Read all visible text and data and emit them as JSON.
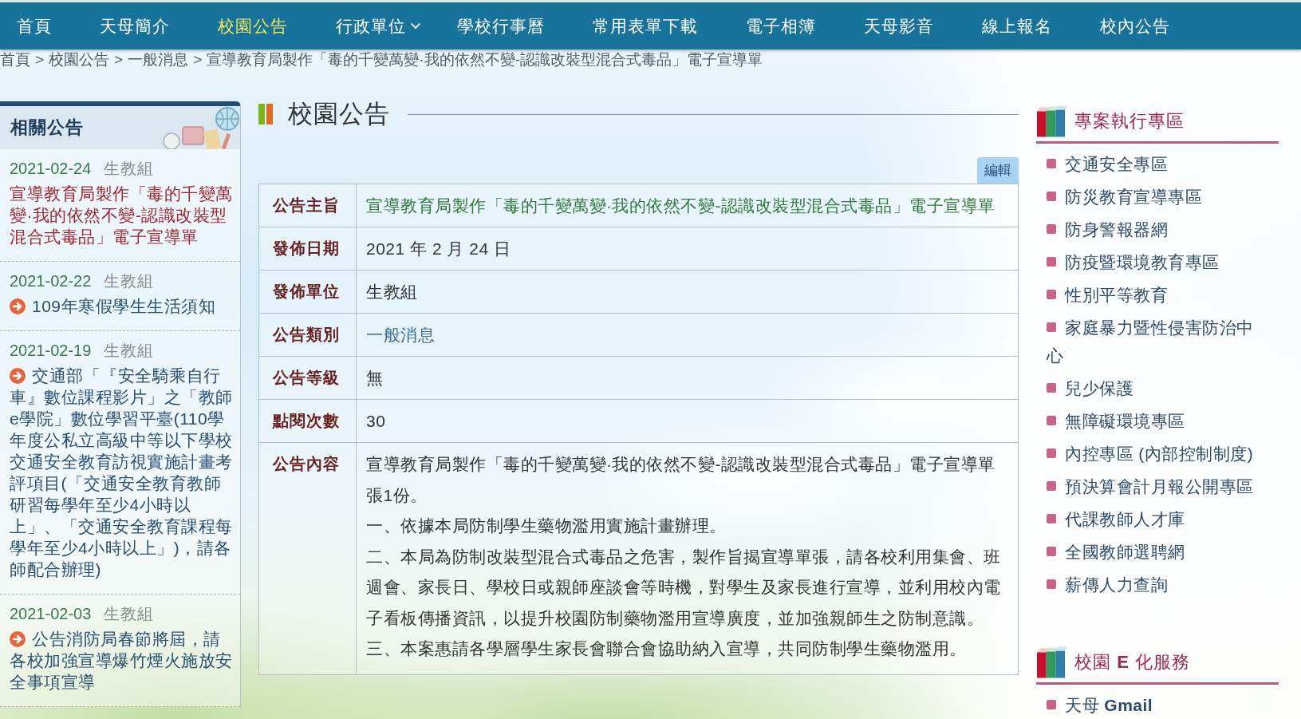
{
  "nav": [
    {
      "label": "首頁",
      "selected": false,
      "dropdown": false
    },
    {
      "label": "天母簡介",
      "selected": false,
      "dropdown": false
    },
    {
      "label": "校園公告",
      "selected": true,
      "dropdown": false
    },
    {
      "label": "行政單位",
      "selected": false,
      "dropdown": true
    },
    {
      "label": "學校行事曆",
      "selected": false,
      "dropdown": false
    },
    {
      "label": "常用表單下載",
      "selected": false,
      "dropdown": false
    },
    {
      "label": "電子相簿",
      "selected": false,
      "dropdown": false
    },
    {
      "label": "天母影音",
      "selected": false,
      "dropdown": false
    },
    {
      "label": "線上報名",
      "selected": false,
      "dropdown": false
    },
    {
      "label": "校內公告",
      "selected": false,
      "dropdown": false
    }
  ],
  "breadcrumb": [
    {
      "kind": "link",
      "label": "首頁"
    },
    {
      "kind": "separator",
      "label": ">"
    },
    {
      "kind": "link",
      "label": "校園公告"
    },
    {
      "kind": "separator",
      "label": ">"
    },
    {
      "kind": "link",
      "label": "一般消息"
    },
    {
      "kind": "separator",
      "label": ">"
    },
    {
      "kind": "link",
      "label": "宣導教育局製作「毒的千變萬變·我的依然不變-認識改裝型混合式毒品」電子宣導單"
    }
  ],
  "related": {
    "title": "相關公告",
    "items": [
      {
        "date": "2021-02-24",
        "unit": "生教組",
        "title": "宣導教育局製作「毒的千變萬變·我的依然不變-認識改裝型混合式毒品」電子宣導單",
        "selected": true
      },
      {
        "date": "2021-02-22",
        "unit": "生教組",
        "title": "109年寒假學生生活須知",
        "selected": false
      },
      {
        "date": "2021-02-19",
        "unit": "生教組",
        "title": "交通部「『安全騎乘自行車』數位課程影片」之「教師e學院」數位學習平臺(110學年度公私立高級中等以下學校交通安全教育訪視實施計畫考評項目(「交通安全教育教師研習每學年至少4小時以上」、「交通安全教育課程每學年至少4小時以上」)，請各師配合辦理)",
        "selected": false
      },
      {
        "date": "2021-02-03",
        "unit": "生教組",
        "title": "公告消防局春節將屆，請各校加強宣導爆竹煙火施放安全事項宣導",
        "selected": false
      }
    ]
  },
  "main": {
    "title": "校園公告",
    "edit_button": "編輯",
    "rows": [
      {
        "label": "公告主旨",
        "kind": "title",
        "value": "宣導教育局製作「毒的千變萬變·我的依然不變-認識改裝型混合式毒品」電子宣導單"
      },
      {
        "label": "發佈日期",
        "kind": "text",
        "value": "2021 年 2 月 24 日"
      },
      {
        "label": "發佈單位",
        "kind": "text",
        "value": "生教組"
      },
      {
        "label": "公告類別",
        "kind": "link",
        "value": "一般消息"
      },
      {
        "label": "公告等級",
        "kind": "text",
        "value": "無"
      },
      {
        "label": "點閱次數",
        "kind": "text",
        "value": "30"
      },
      {
        "label": "公告內容",
        "kind": "content",
        "paragraphs": [
          "宣導教育局製作「毒的千變萬變·我的依然不變-認識改裝型混合式毒品」電子宣導單張1份。",
          "一、依據本局防制學生藥物濫用實施計畫辦理。",
          "二、本局為防制改裝型混合式毒品之危害，製作旨揭宣導單張，請各校利用集會、班週會、家長日、學校日或親師座談會等時機，對學生及家長進行宣導，並利用校內電子看板傳播資訊，以提升校園防制藥物濫用宣導廣度，並加強親師生之防制意識。",
          "三、本案惠請各學層學生家長會聯合會協助納入宣導，共同防制學生藥物濫用。"
        ]
      }
    ]
  },
  "side_sections": [
    {
      "title": "專案執行專區",
      "items": [
        "交通安全專區",
        "防災教育宣導專區",
        "防身警報器網",
        "防疫暨環境教育專區",
        "性別平等教育",
        "家庭暴力暨性侵害防治中心",
        "兒少保護",
        "無障礙環境專區",
        "內控專區 (內部控制制度)",
        "預決算會計月報公開專區",
        "代課教師人才庫",
        "全國教師選聘網",
        "薪傳人力查詢"
      ]
    },
    {
      "title": "校園 **E** 化服務",
      "items": [
        "天母 **Gmail**"
      ]
    }
  ]
}
